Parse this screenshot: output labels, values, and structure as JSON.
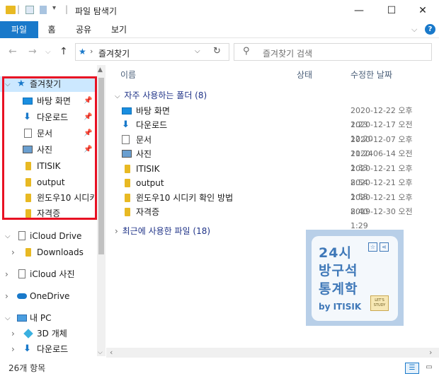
{
  "window": {
    "title": "파일 탐색기",
    "minimize": "—",
    "maximize": "☐",
    "close": "✕"
  },
  "ribbon": {
    "tabs": [
      "파일",
      "홈",
      "공유",
      "보기"
    ]
  },
  "address": {
    "path": "즐겨찾기",
    "search_placeholder": "즐겨찾기 검색"
  },
  "sidebar": {
    "quick_access": "즐겨찾기",
    "pinned": [
      "바탕 화면",
      "다운로드",
      "문서",
      "사진"
    ],
    "others": [
      "ITISIK",
      "output",
      "윈도우10 시디키",
      "자격증"
    ],
    "icloud_drive": "iCloud Drive",
    "downloads": "Downloads",
    "icloud_photos": "iCloud 사진",
    "onedrive": "OneDrive",
    "pc": "내 PC",
    "objects3d": "3D 개체",
    "pc_downloads": "다운로드"
  },
  "columns": {
    "name": "이름",
    "status": "상태",
    "modified": "수정한 날짜"
  },
  "groups": {
    "frequent": "자주 사용하는 폴더 (8)",
    "recent": "최근에 사용한 파일 (18)"
  },
  "rows": [
    {
      "name": "바탕 화면",
      "date": "2020-12-22 오후 1:23"
    },
    {
      "name": "다운로드",
      "date": "2020-12-17 오전 12:20"
    },
    {
      "name": "문서",
      "date": "2020-12-07 오후 11:24"
    },
    {
      "name": "사진",
      "date": "2020-06-14 오전 1:33"
    },
    {
      "name": "ITISIK",
      "date": "2020-12-21 오후 8:54"
    },
    {
      "name": "output",
      "date": "2020-12-21 오후 1:58"
    },
    {
      "name": "윈도우10 시디키 확인 방법",
      "date": "2020-12-21 오후 8:40"
    },
    {
      "name": "자격증",
      "date": "2019-12-30 오전 1:29"
    }
  ],
  "thumbnail": {
    "line1": "24시",
    "line2": "방구석",
    "line3": "통계학",
    "footer": "by ITISIK",
    "badge": "LET'S STUDY"
  },
  "status": {
    "count": "26개 항목"
  },
  "colors": {
    "accent": "#1979ca",
    "folder": "#e8b923",
    "highlight": "#e81123",
    "selected_bg": "#cce8ff"
  }
}
